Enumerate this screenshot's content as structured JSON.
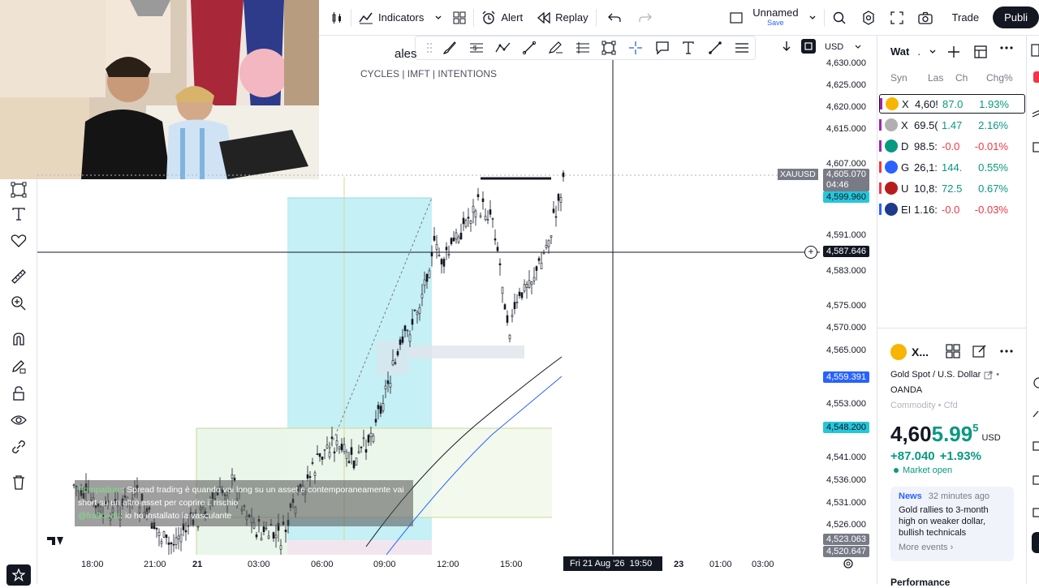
{
  "toolbar": {
    "indicators_label": "Indicators",
    "alert_label": "Alert",
    "replay_label": "Replay",
    "layout_name": "Unnamed",
    "save_label": "Save",
    "trade_label": "Trade",
    "publish_label": "Publi"
  },
  "drawing_toolbar": {
    "currency": "USD"
  },
  "chart": {
    "title_partial": "ales",
    "indicator_labels": "CYCLES  | IMFT |  INTENTIONS",
    "symbol_tag": "XAUUSD",
    "price_labels": [
      "4,630.000",
      "4,625.000",
      "4,620.000",
      "4,615.000",
      "4,607.000",
      "4,591.000",
      "4,583.000",
      "4,575.000",
      "4,570.000",
      "4,565.000",
      "4,553.000",
      "4,541.000",
      "4,536.000",
      "4,531.000",
      "4,526.000"
    ],
    "current_price": "4,605.070",
    "countdown": "04:46",
    "tag_cyan": "4,599.960",
    "crosshair_price": "4,587.646",
    "tag_blue": "4,559.391",
    "tag_teal": "4,548.200",
    "tag_gray_1": "4,523.063",
    "tag_gray_2": "4,520.647",
    "time_labels": [
      "18:00",
      "21:00",
      "21",
      "03:00",
      "06:00",
      "09:00",
      "12:00",
      "15:00",
      "23",
      "01:00",
      "03:00"
    ],
    "crosshair_time": "Fri 21 Aug '26",
    "crosshair_time_2": "19:50",
    "colors": {
      "cyan_zone": "#b2ebf2",
      "green_zone": "#e8f5e9",
      "candle": "#131722",
      "blue_ma": "#2962ff"
    }
  },
  "chat": {
    "user1": "Pompaduro",
    "msg1": ": Spread trading è quando vai long su un asset e contemporaneamente vai short su un altro asset per coprire il rischio",
    "user2": "@fra9o-y9t",
    "msg2": ": io ho installato la vasculante"
  },
  "watchlist": {
    "title": "Wat",
    "headers": {
      "sym": "Syn",
      "last": "Las",
      "chg": "Ch",
      "chgp": "Chg%"
    },
    "rows": [
      {
        "sym": "X",
        "last": "4,60!",
        "chg": "87.0",
        "chgp": "1.93%",
        "mark": "#9c27b0",
        "icon": "#f7b500",
        "chg_dir": "pos"
      },
      {
        "sym": "X",
        "last": "69.5(",
        "chg": "1.47",
        "chgp": "2.16%",
        "mark": "#9c27b0",
        "icon": "#b0b0b0",
        "chg_dir": "pos"
      },
      {
        "sym": "D",
        "last": "98.5:",
        "chg": "-0.0",
        "chgp": "-0.01%",
        "mark": "#9c27b0",
        "icon": "#089981",
        "chg_dir": "neg"
      },
      {
        "sym": "G",
        "last": "26,1:",
        "chg": "144.",
        "chgp": "0.55%",
        "mark": "#f23645",
        "icon": "#2962ff",
        "chg_dir": "pos"
      },
      {
        "sym": "U",
        "last": "10,8:",
        "chg": "72.5",
        "chgp": "0.67%",
        "mark": "#f23645",
        "icon": "#b71c1c",
        "chg_dir": "pos"
      },
      {
        "sym": "EI",
        "last": "1.16:",
        "chg": "-0.0",
        "chgp": "-0.03%",
        "mark": "#2962ff",
        "icon": "#1e3a8a",
        "chg_dir": "neg"
      }
    ]
  },
  "details": {
    "symbol_short": "X...",
    "name": "Gold Spot / U.S. Dollar",
    "exchange": "OANDA",
    "category": "Commodity • Cfd",
    "price_main": "4,60",
    "price_rest": "5.99",
    "price_sup": "5",
    "currency": "USD",
    "change": "+87.040",
    "change_pct": "+1.93%",
    "market_status": "Market open",
    "news_label": "News",
    "news_time": "32 minutes ago",
    "news_headline": "Gold rallies to 3-month high on weaker dollar, bullish technicals",
    "more_events": "More events ›",
    "performance": "Performance"
  }
}
